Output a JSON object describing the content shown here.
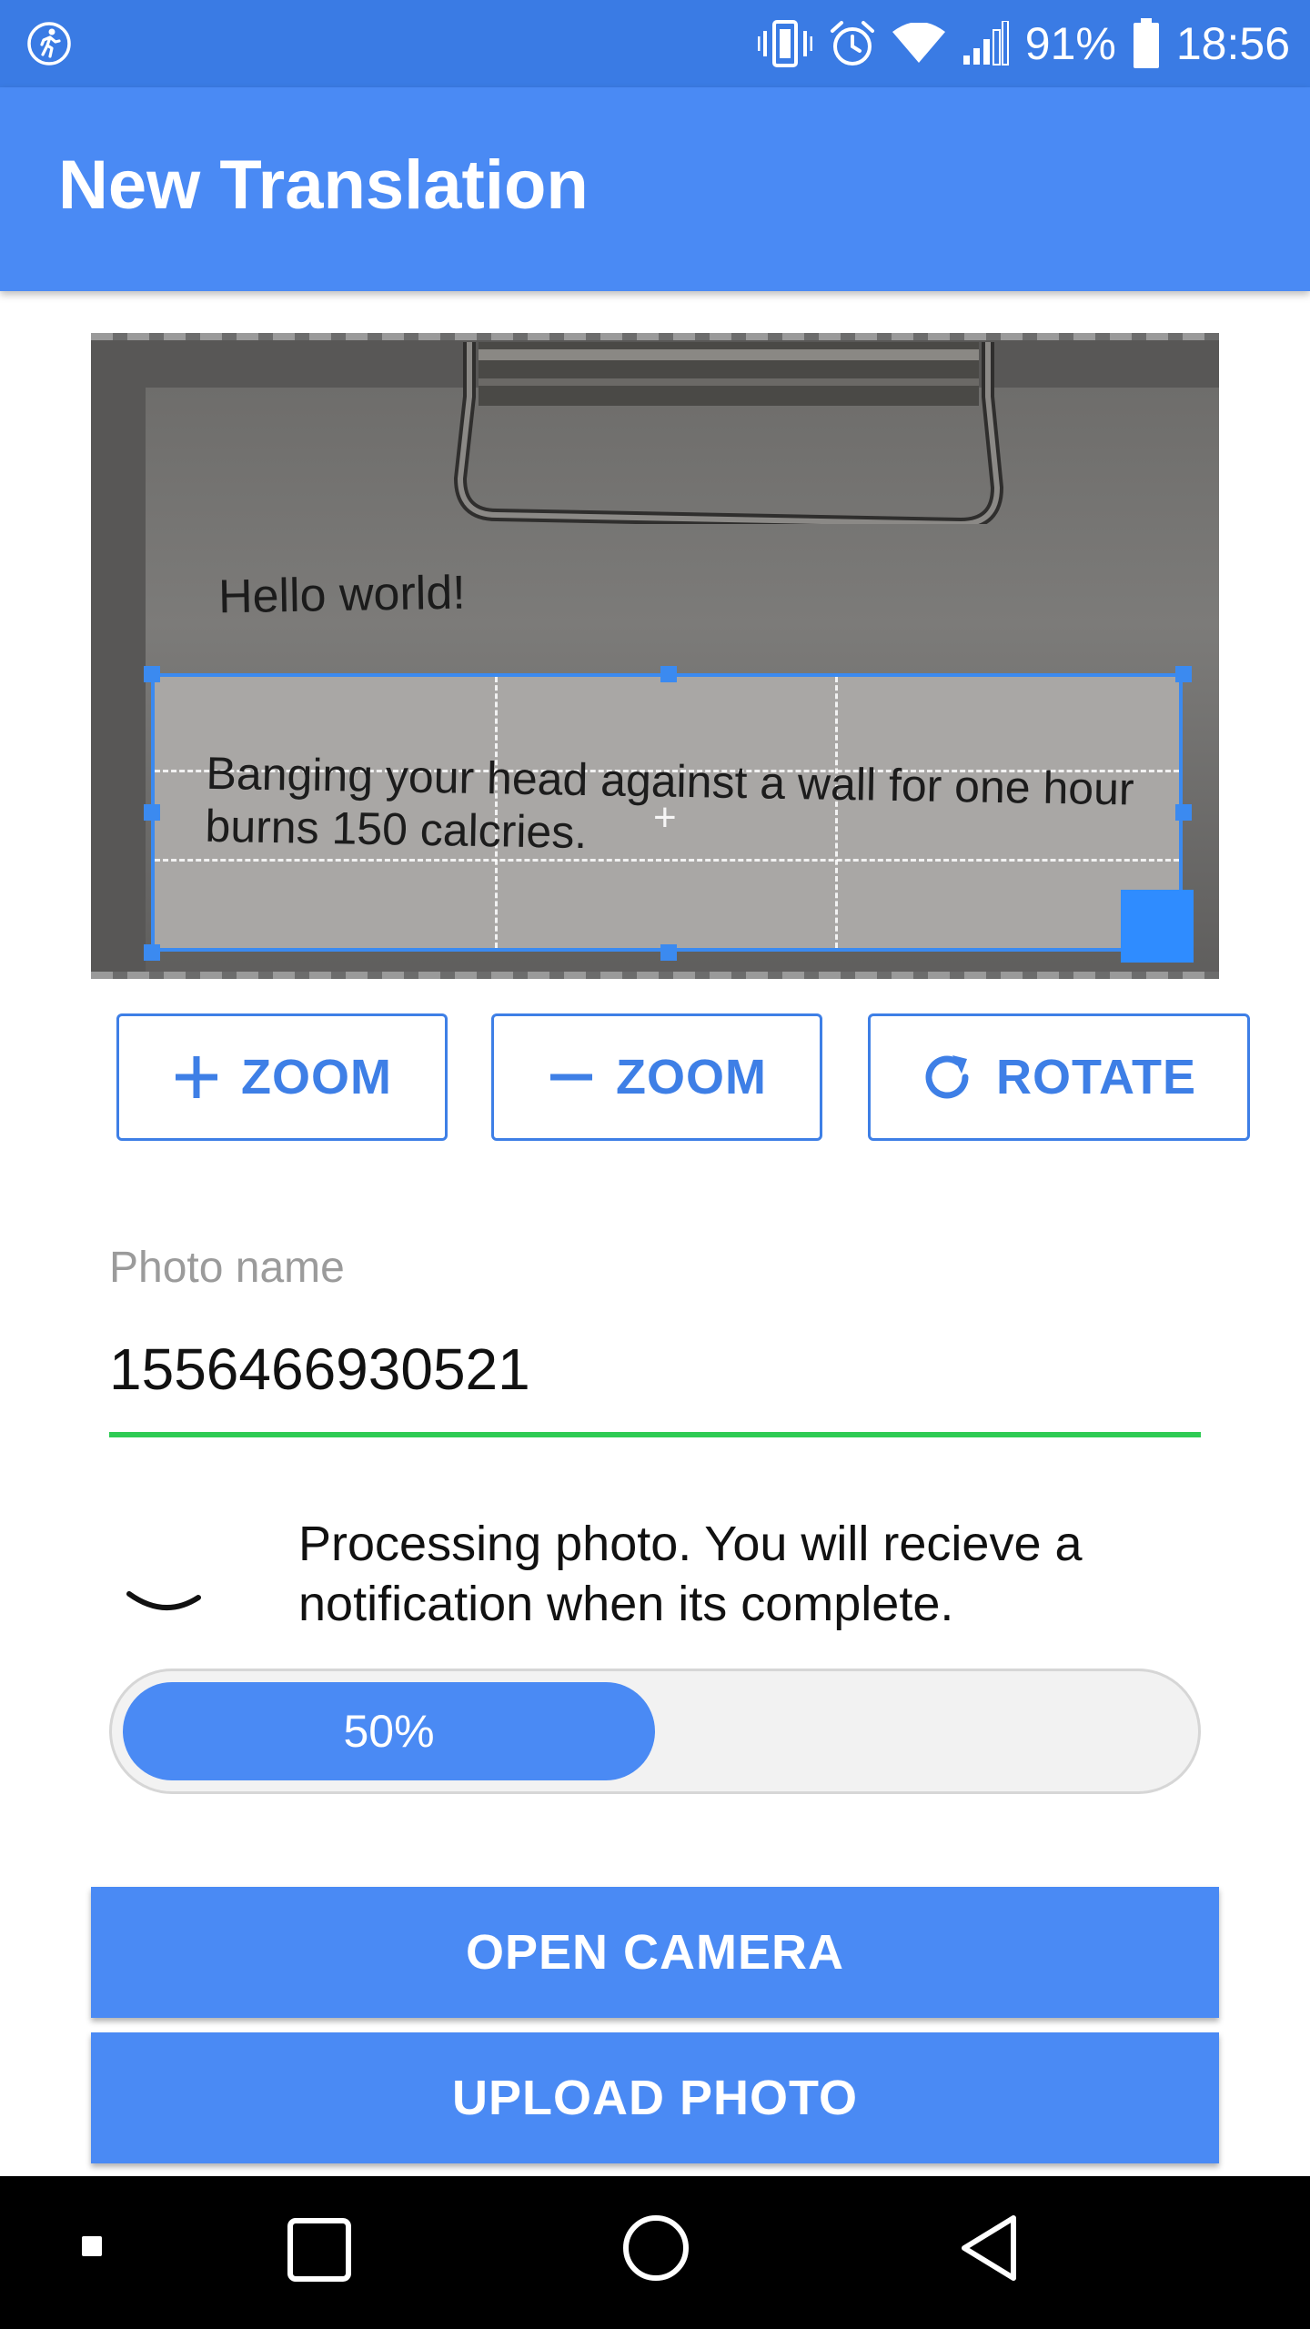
{
  "status_bar": {
    "battery": "91%",
    "time": "18:56",
    "icons": [
      "activity-tracker-icon",
      "vibrate-icon",
      "alarm-icon",
      "wifi-icon",
      "signal-icon",
      "battery-icon"
    ]
  },
  "app_bar": {
    "title": "New Translation"
  },
  "photo": {
    "text_line_1": "Hello world!",
    "crop_text": "Banging your head against a wall for one hour burns 150 calcries."
  },
  "actions": {
    "zoom_in": "ZOOM",
    "zoom_out": "ZOOM",
    "rotate": "ROTATE"
  },
  "photo_name": {
    "label": "Photo name",
    "value": "1556466930521"
  },
  "processing": {
    "message": "Processing photo. You will recieve a notification when its complete.",
    "progress_label": "50%",
    "progress_fraction": 0.5
  },
  "buttons": {
    "open_camera": "OPEN CAMERA",
    "upload_photo": "UPLOAD PHOTO"
  },
  "colors": {
    "primary": "#4a8af4",
    "status_bar": "#3a7be4",
    "accent_underline": "#2ecb54",
    "outline": "#3e7fe6"
  }
}
